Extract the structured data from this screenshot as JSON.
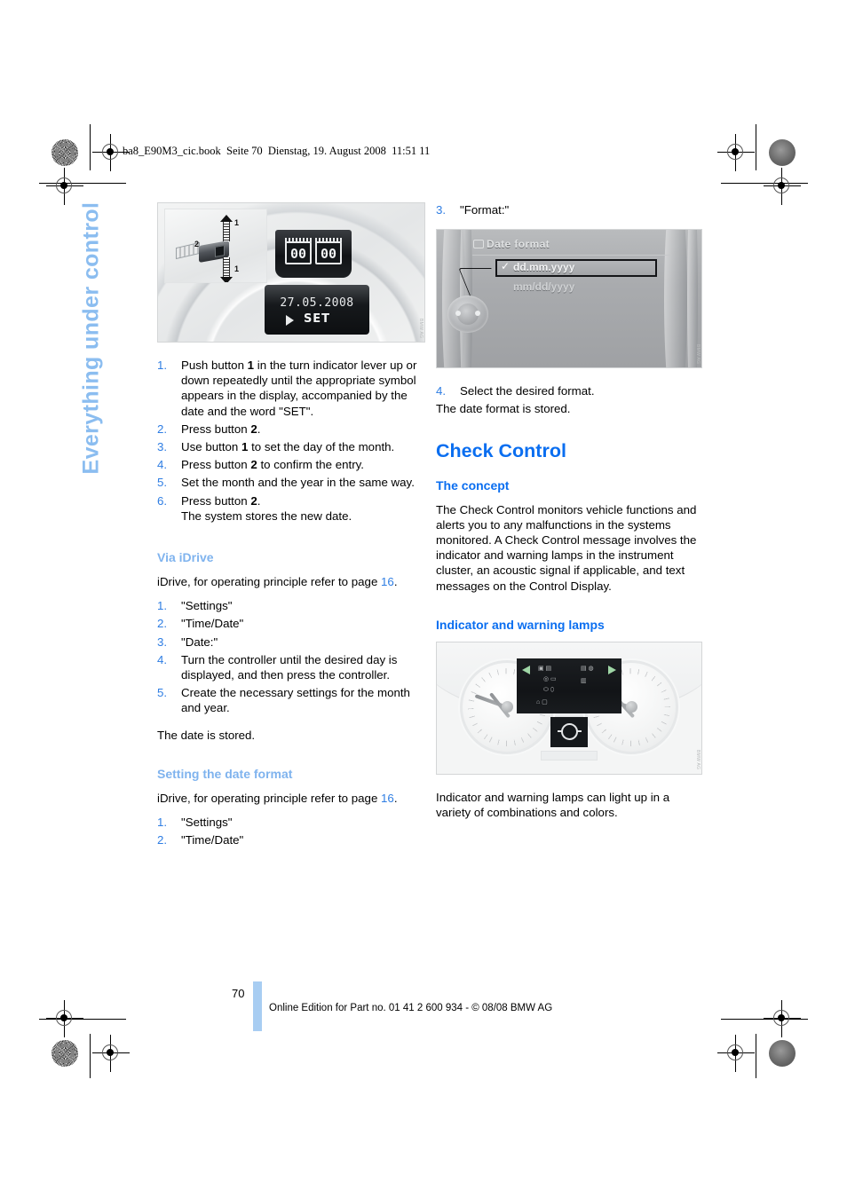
{
  "document": {
    "header_slug": "ba8_E90M3_cic.book  Seite 70  Dienstag, 19. August 2008  11:51 11",
    "chapter_tab": "Everything under control",
    "page_number": "70",
    "footer": "Online Edition for Part no. 01 41 2 600 934 - © 08/08 BMW AG"
  },
  "left_column": {
    "figure_lever": {
      "caption_id": "",
      "callout_1": "1",
      "callout_1b": "1",
      "callout_2": "2",
      "digit_left": "00",
      "digit_right": "00",
      "display_date": "27.05.2008",
      "display_set": "SET"
    },
    "steps_manual": [
      {
        "num": "1.",
        "text_parts": [
          {
            "t": "Push button "
          },
          {
            "t": "1",
            "b": true
          },
          {
            "t": " in the turn indicator lever up or down repeatedly until the appropriate symbol appears in the display, accompanied by the date and the word \"SET\"."
          }
        ]
      },
      {
        "num": "2.",
        "text_parts": [
          {
            "t": "Press button "
          },
          {
            "t": "2",
            "b": true
          },
          {
            "t": "."
          }
        ]
      },
      {
        "num": "3.",
        "text_parts": [
          {
            "t": "Use button "
          },
          {
            "t": "1",
            "b": true
          },
          {
            "t": " to set the day of the month."
          }
        ]
      },
      {
        "num": "4.",
        "text_parts": [
          {
            "t": "Press button "
          },
          {
            "t": "2",
            "b": true
          },
          {
            "t": " to confirm the entry."
          }
        ]
      },
      {
        "num": "5.",
        "text_parts": [
          {
            "t": "Set the month and the year in the same way."
          }
        ]
      },
      {
        "num": "6.",
        "text_parts": [
          {
            "t": "Press button "
          },
          {
            "t": "2",
            "b": true
          },
          {
            "t": ".\nThe system stores the new date."
          }
        ]
      }
    ],
    "via_idrive": {
      "heading": "Via iDrive",
      "intro_before": "iDrive, for operating principle refer to page ",
      "intro_pageref": "16",
      "intro_after": ".",
      "steps": [
        {
          "num": "1.",
          "text": "\"Settings\""
        },
        {
          "num": "2.",
          "text": "\"Time/Date\""
        },
        {
          "num": "3.",
          "text": "\"Date:\""
        },
        {
          "num": "4.",
          "text": "Turn the controller until the desired day is displayed, and then press the controller."
        },
        {
          "num": "5.",
          "text": "Create the necessary settings for the month and year."
        }
      ],
      "closing": "The date is stored."
    },
    "setting_date_format": {
      "heading": "Setting the date format",
      "intro_before": "iDrive, for operating principle refer to page ",
      "intro_pageref": "16",
      "intro_after": ".",
      "steps": [
        {
          "num": "1.",
          "text": "\"Settings\""
        },
        {
          "num": "2.",
          "text": "\"Time/Date\""
        }
      ]
    }
  },
  "right_column": {
    "step_3": {
      "num": "3.",
      "text": "\"Format:\""
    },
    "figure_date_format": {
      "screen_title": "Date format",
      "option_selected": "dd.mm.yyyy",
      "option_other": "mm/dd/yyyy",
      "check_glyph": "✓"
    },
    "step_4": {
      "num": "4.",
      "text": "Select the desired format."
    },
    "after_step_4": "The date format is stored.",
    "check_control": {
      "title": "Check Control",
      "concept_heading": "The concept",
      "concept_body": "The Check Control monitors vehicle functions and alerts you to any malfunctions in the systems monitored. A Check Control message involves the indicator and warning lamps in the instrument cluster, an acoustic signal if applicable, and text messages on the Control Display.",
      "lamps_heading": "Indicator and warning lamps",
      "lamps_body": "Indicator and warning lamps can light up in a variety of combinations and colors."
    }
  },
  "colors": {
    "heading_blue": "#0a6ef0",
    "subheading_light_blue": "#7fb3ee",
    "chapter_tab_blue": "#8bbdf0",
    "page_ref_blue": "#2e7de3",
    "footer_bar_blue": "#a8cdf2"
  }
}
